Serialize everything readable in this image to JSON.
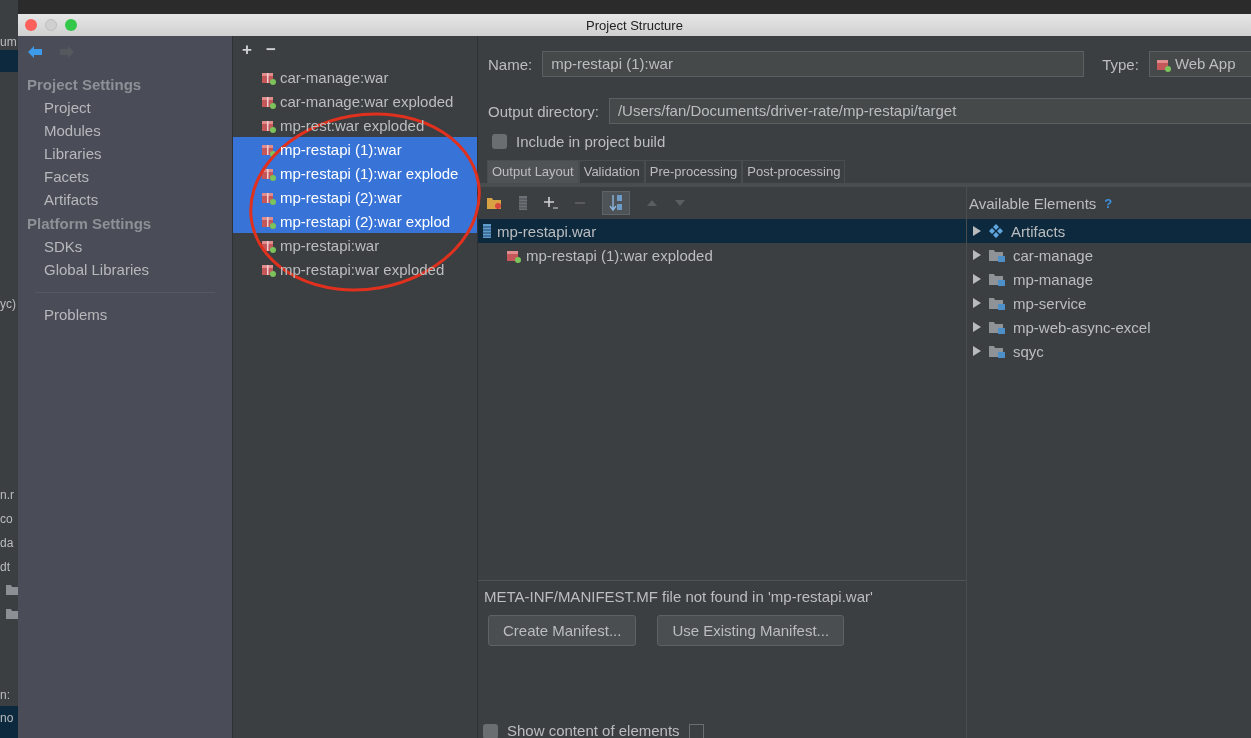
{
  "background_editor": {
    "fragments": [
      "um",
      "yc)",
      "n.r",
      "co",
      "da",
      "dt",
      "n:",
      "no"
    ]
  },
  "window": {
    "title": "Project Structure"
  },
  "sidebar": {
    "groups": [
      {
        "title": "Project Settings",
        "items": [
          {
            "label": "Project",
            "selected": false
          },
          {
            "label": "Modules",
            "selected": false
          },
          {
            "label": "Libraries",
            "selected": false
          },
          {
            "label": "Facets",
            "selected": false
          },
          {
            "label": "Artifacts",
            "selected": false
          }
        ]
      },
      {
        "title": "Platform Settings",
        "items": [
          {
            "label": "SDKs",
            "selected": false
          },
          {
            "label": "Global Libraries",
            "selected": false
          }
        ]
      }
    ],
    "bottom_items": [
      {
        "label": "Problems",
        "selected": false
      }
    ]
  },
  "artifact_list": {
    "add": "+",
    "remove": "−",
    "items": [
      {
        "label": "car-manage:war",
        "selected": false
      },
      {
        "label": "car-manage:war exploded",
        "selected": false
      },
      {
        "label": "mp-rest:war exploded",
        "selected": false
      },
      {
        "label": "mp-restapi (1):war",
        "selected": true
      },
      {
        "label": "mp-restapi (1):war explode",
        "selected": true
      },
      {
        "label": "mp-restapi (2):war",
        "selected": true
      },
      {
        "label": "mp-restapi (2):war explod",
        "selected": true
      },
      {
        "label": "mp-restapi:war",
        "selected": false
      },
      {
        "label": "mp-restapi:war exploded",
        "selected": false
      }
    ]
  },
  "details": {
    "name_label": "Name:",
    "name_value": "mp-restapi (1):war",
    "type_label": "Type:",
    "type_value": "Web App",
    "output_label": "Output directory:",
    "output_value": "/Users/fan/Documents/driver-rate/mp-restapi/target",
    "include_build": {
      "label": "Include in project build",
      "checked": false
    },
    "tabs": [
      {
        "label": "Output Layout",
        "selected": true
      },
      {
        "label": "Validation",
        "selected": false
      },
      {
        "label": "Pre-processing",
        "selected": false
      },
      {
        "label": "Post-processing",
        "selected": false
      }
    ],
    "layout_tree": [
      {
        "label": "mp-restapi.war",
        "kind": "archive",
        "selected": true,
        "children": [
          {
            "label": "mp-restapi (1):war exploded",
            "kind": "artifact",
            "selected": false
          }
        ]
      }
    ],
    "available_title": "Available Elements",
    "available_help": "?",
    "available_tree": [
      {
        "label": "Artifacts",
        "kind": "artifacts",
        "selected": true,
        "expanded": false
      },
      {
        "label": "car-manage",
        "kind": "module",
        "selected": false,
        "expanded": false
      },
      {
        "label": "mp-manage",
        "kind": "module",
        "selected": false,
        "expanded": false
      },
      {
        "label": "mp-service",
        "kind": "module",
        "selected": false,
        "expanded": false
      },
      {
        "label": "mp-web-async-excel",
        "kind": "module",
        "selected": false,
        "expanded": false
      },
      {
        "label": "sqyc",
        "kind": "module",
        "selected": false,
        "expanded": false
      }
    ],
    "message": "META-INF/MANIFEST.MF file not found in 'mp-restapi.war'",
    "buttons": [
      "Create Manifest...",
      "Use Existing Manifest..."
    ],
    "show_content": {
      "label": "Show content of elements",
      "checked": false
    }
  }
}
